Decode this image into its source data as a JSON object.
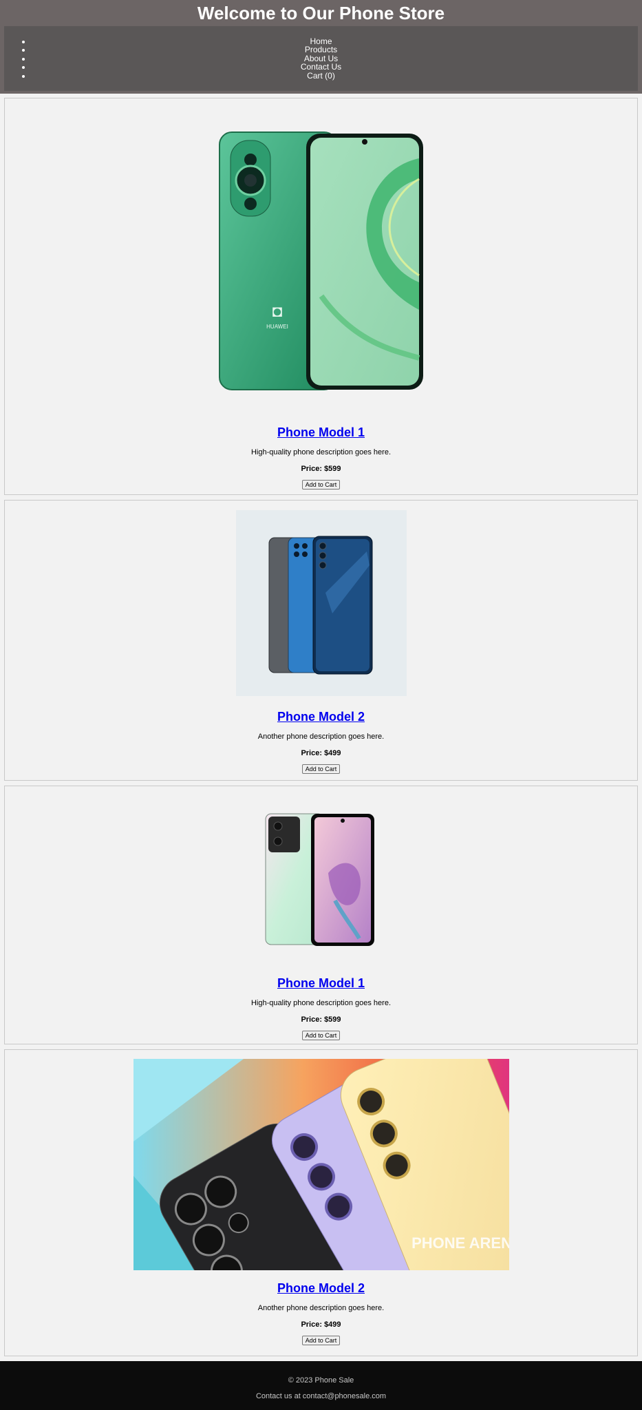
{
  "header": {
    "title": "Welcome to Our Phone Store"
  },
  "nav": {
    "items": [
      "Home",
      "Products",
      "About Us",
      "Contact Us",
      "Cart (0)"
    ]
  },
  "products": [
    {
      "name": "Phone Model 1",
      "description": "High-quality phone description goes here.",
      "price": "Price: $599",
      "button": "Add to Cart",
      "image_brand": "HUAWEI"
    },
    {
      "name": "Phone Model 2",
      "description": "Another phone description goes here.",
      "price": "Price: $499",
      "button": "Add to Cart"
    },
    {
      "name": "Phone Model 1",
      "description": "High-quality phone description goes here.",
      "price": "Price: $599",
      "button": "Add to Cart"
    },
    {
      "name": "Phone Model 2",
      "description": "Another phone description goes here.",
      "price": "Price: $499",
      "button": "Add to Cart",
      "image_watermark": "PHONE ARENA"
    }
  ],
  "footer": {
    "copyright": "© 2023 Phone Sale",
    "contact": "Contact us at contact@phonesale.com"
  },
  "colors": {
    "header_bg": "#6c6565",
    "nav_bg": "#5a5757",
    "page_bg": "#f2f2f2",
    "link": "#0000ee",
    "footer_bg": "#0c0c0c"
  }
}
